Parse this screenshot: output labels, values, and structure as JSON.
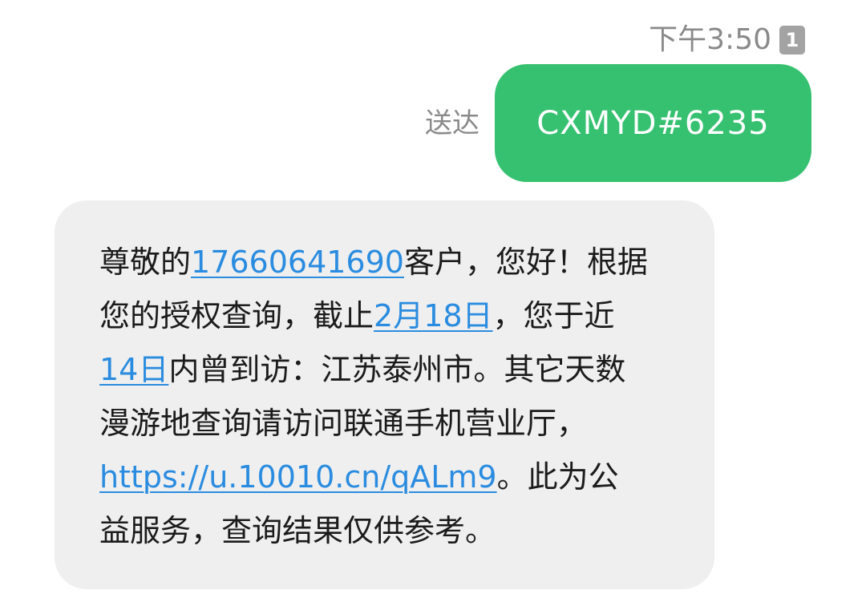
{
  "header": {
    "timestamp": "下午3:50",
    "sim_badge": "1"
  },
  "sent_message": {
    "status": "送达",
    "text": "CXMYD#6235",
    "bubble_color": "#36c170"
  },
  "received_message": {
    "bubble_color": "#efefef",
    "link_color": "#2a8ce0",
    "line1_prefix": "尊敬的",
    "phone_link": "17660641690",
    "line1_suffix": "客户，您好！根据",
    "line2_prefix": "您的授权查询，截止",
    "date_link": "2月18日",
    "line2_suffix": "，您于近",
    "days_link": "14日",
    "line3_suffix": "内曾到访：江苏泰州市。其它天数",
    "line4": "漫游地查询请访问联通手机营业厅，",
    "url_link": "https://u.10010.cn/qALm9",
    "line5_suffix": "。此为公",
    "line6": "益服务，查询结果仅供参考。"
  }
}
